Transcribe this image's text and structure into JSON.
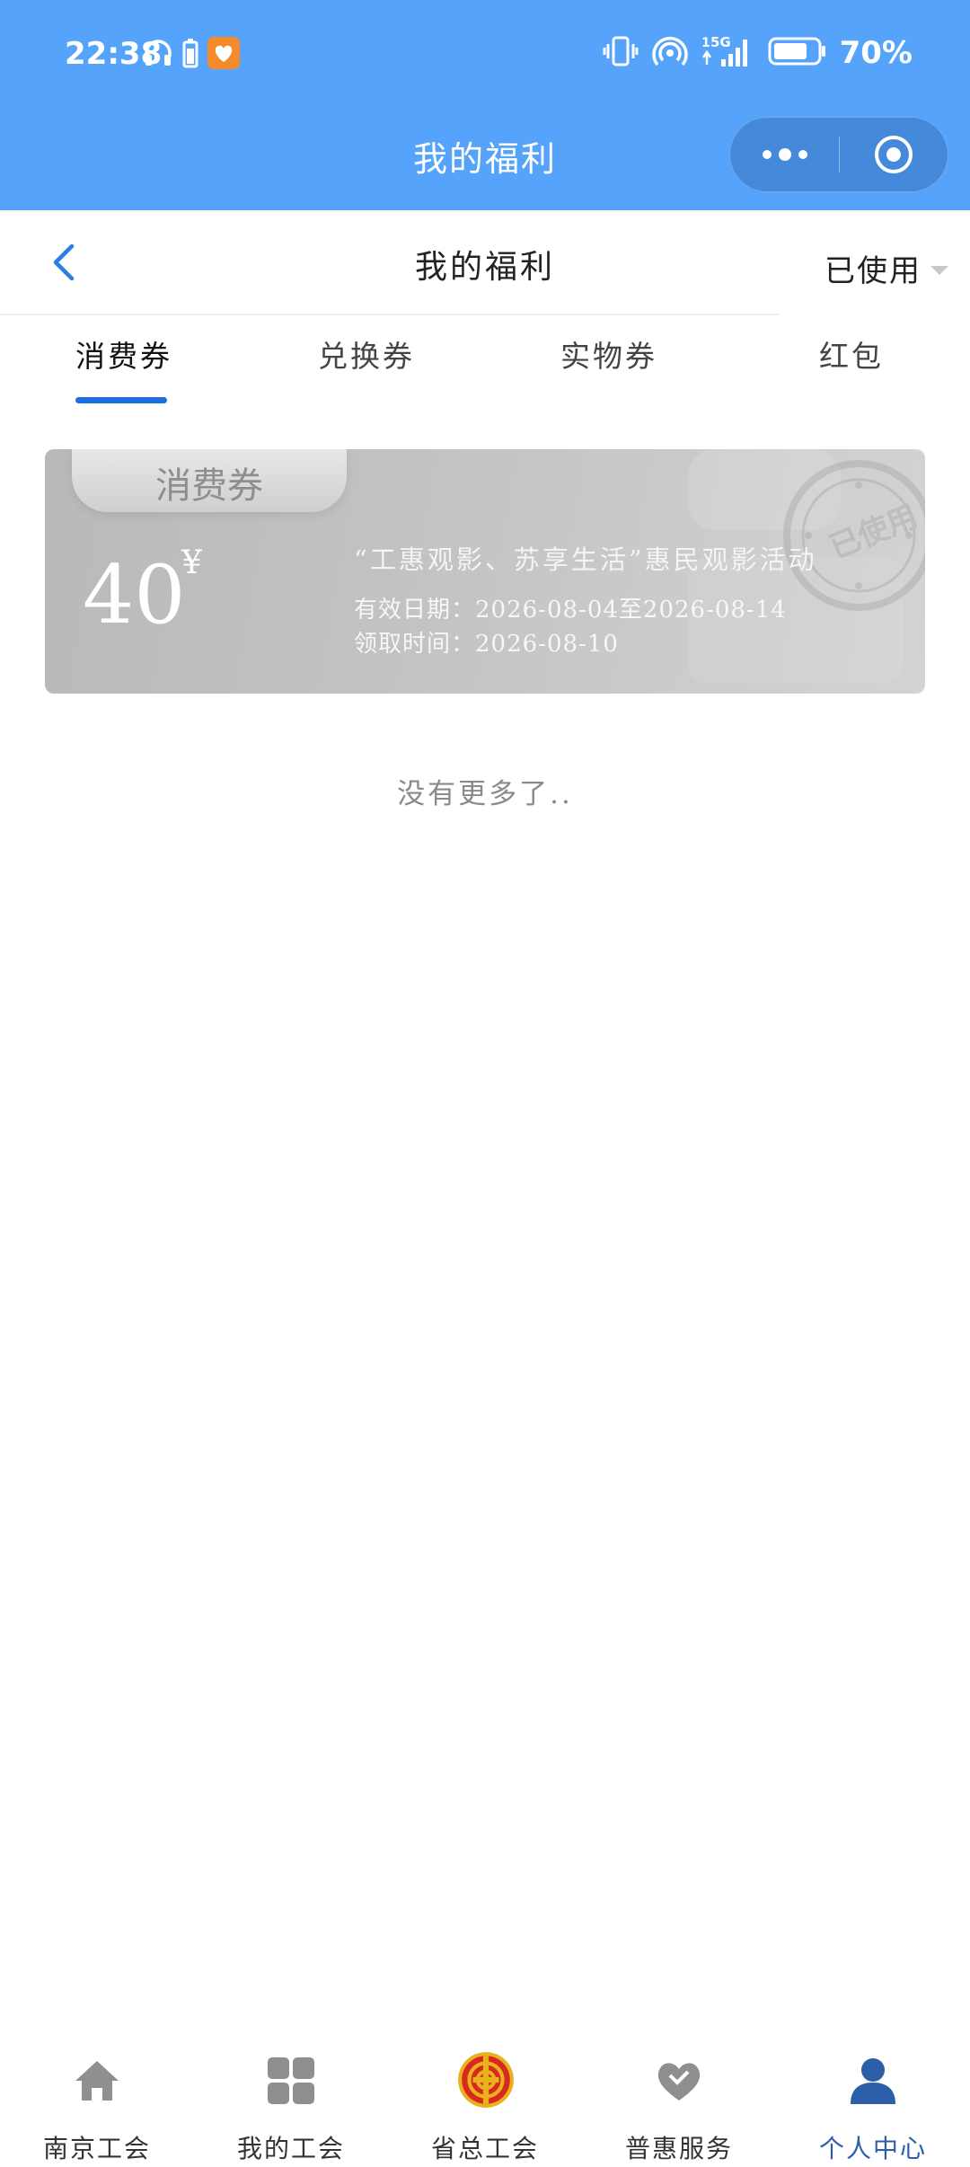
{
  "status_bar": {
    "time": "22:38",
    "battery": "70%",
    "network": "5G",
    "icons_left": [
      "headphones-icon",
      "battery-saver-icon",
      "app-notification-icon"
    ],
    "icons_right": [
      "vibrate-icon",
      "hotspot-icon",
      "signal-icon",
      "battery-icon"
    ]
  },
  "mini_program": {
    "title": "我的福利",
    "capsule": [
      "more-icon",
      "close-target-icon"
    ]
  },
  "nav": {
    "title": "我的福利",
    "filter_label": "已使用"
  },
  "tabs": [
    {
      "label": "消费券",
      "active": true
    },
    {
      "label": "兑换券",
      "active": false
    },
    {
      "label": "实物券",
      "active": false
    },
    {
      "label": "红包",
      "active": false
    }
  ],
  "coupons": [
    {
      "tag": "消费券",
      "amount": "40",
      "currency": "¥",
      "title": "“工惠观影、苏享生活”惠民观影活动",
      "valid_label": "有效日期：",
      "valid_range": "2026-08-04至2026-08-14",
      "claimed_label": "领取时间：",
      "claimed_time": "2026-08-10",
      "stamp": "已使用",
      "status": "used"
    }
  ],
  "list_end_text": "没有更多了..",
  "bottom_tabs": [
    {
      "label": "南京工会",
      "icon": "home-icon",
      "active": false
    },
    {
      "label": "我的工会",
      "icon": "grid-icon",
      "active": false
    },
    {
      "label": "省总工会",
      "icon": "union-emblem-icon",
      "active": false
    },
    {
      "label": "普惠服务",
      "icon": "heart-icon",
      "active": false
    },
    {
      "label": "个人中心",
      "icon": "person-icon",
      "active": true
    }
  ],
  "colors": {
    "header_blue": "#55a3fa",
    "tab_indicator": "#1e6fe0",
    "active_tab_label": "#2c5fa8",
    "coupon_used_grey": "#c2c2c2"
  }
}
